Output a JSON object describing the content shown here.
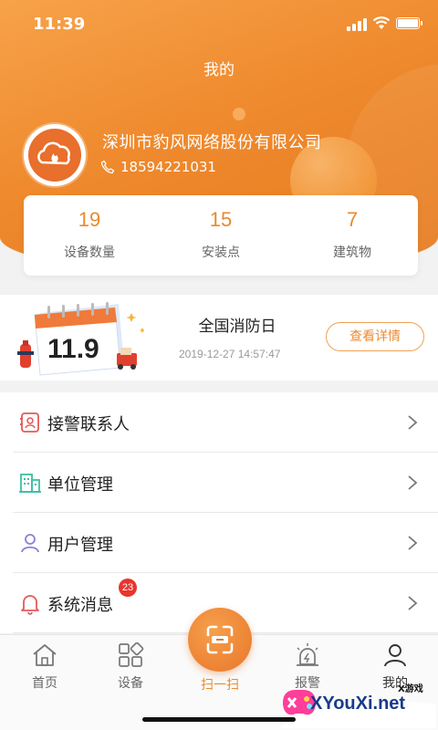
{
  "status_bar": {
    "time": "11:39"
  },
  "header": {
    "title": "我的"
  },
  "profile": {
    "company": "深圳市豹风网络股份有限公司",
    "phone": "18594221031"
  },
  "stats": [
    {
      "value": "19",
      "label": "设备数量"
    },
    {
      "value": "15",
      "label": "安装点"
    },
    {
      "value": "7",
      "label": "建筑物"
    }
  ],
  "event": {
    "calendar_text": "11.9",
    "title": "全国消防日",
    "time": "2019-12-27 14:57:47",
    "detail_button": "查看详情"
  },
  "menu": [
    {
      "label": "接警联系人",
      "icon": "contact-card-icon"
    },
    {
      "label": "单位管理",
      "icon": "building-icon"
    },
    {
      "label": "用户管理",
      "icon": "user-icon"
    },
    {
      "label": "系统消息",
      "icon": "bell-icon",
      "badge": "23"
    }
  ],
  "tabbar": {
    "home": "首页",
    "devices": "设备",
    "scan": "扫一扫",
    "alarm": "报警",
    "mine": "我的"
  },
  "watermark": {
    "tag": "X游戏",
    "text": "XYouXi.net"
  },
  "colors": {
    "accent": "#ec8a30",
    "badge": "#e8352e"
  }
}
